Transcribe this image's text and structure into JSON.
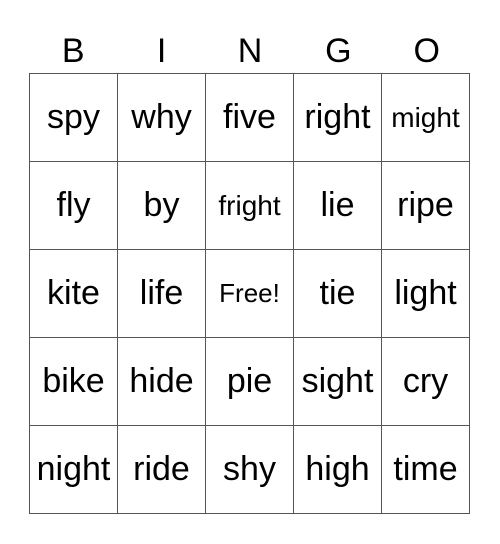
{
  "header": [
    "B",
    "I",
    "N",
    "G",
    "O"
  ],
  "rows": [
    [
      "spy",
      "why",
      "five",
      "right",
      "might"
    ],
    [
      "fly",
      "by",
      "fright",
      "lie",
      "ripe"
    ],
    [
      "kite",
      "life",
      "Free!",
      "tie",
      "light"
    ],
    [
      "bike",
      "hide",
      "pie",
      "sight",
      "cry"
    ],
    [
      "night",
      "ride",
      "shy",
      "high",
      "time"
    ]
  ]
}
